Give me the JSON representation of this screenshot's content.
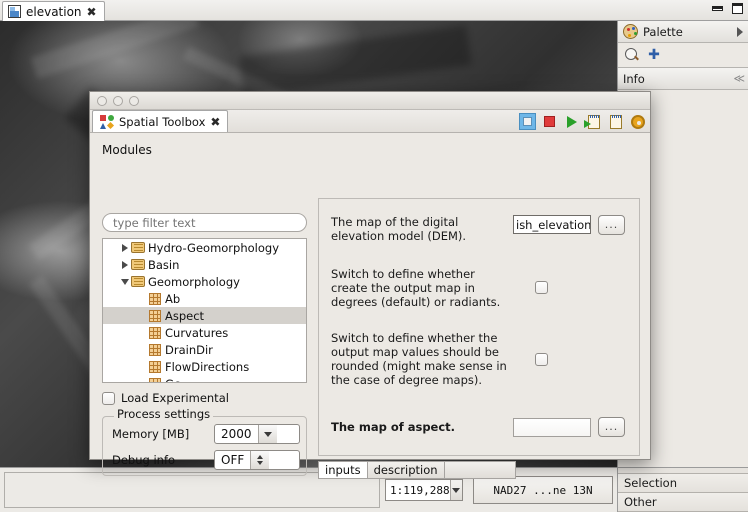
{
  "app": {
    "tab": {
      "label": "elevation",
      "icon": "map-document-icon",
      "close": "✖"
    },
    "window_controls": {
      "minimize": "minimize-icon",
      "maximize": "maximize-icon"
    }
  },
  "right_dock": {
    "palette": {
      "title": "Palette",
      "icon": "palette-icon",
      "expand": "expand-arrow-icon"
    },
    "tools": [
      {
        "name": "zoom-tool",
        "icon": "magnifier-icon"
      },
      {
        "name": "pan-tool",
        "icon": "move-icon"
      }
    ],
    "info": {
      "title": "Info",
      "collapse": "collapse-icon"
    }
  },
  "bottom_right_panels": [
    {
      "label": "Selection"
    },
    {
      "label": "Other"
    }
  ],
  "statusbar": {
    "scale": {
      "value": "1:119,288",
      "dropdown": "chevron-down-icon"
    },
    "crs": "NAD27 ...ne 13N"
  },
  "toolbox": {
    "titlebar_dots": [
      "close-dot",
      "minimize-dot",
      "zoom-dot"
    ],
    "tab": {
      "label": "Spatial Toolbox",
      "icon": "spatial-toolbox-icon",
      "close": "✖"
    },
    "toolbar": [
      {
        "name": "stop-selected-button",
        "icon": "stop-white-icon",
        "selected": true
      },
      {
        "name": "stop-button",
        "icon": "stop-red-icon",
        "selected": false
      },
      {
        "name": "run-button",
        "icon": "play-green-icon",
        "selected": false
      },
      {
        "name": "run-script-button",
        "icon": "script-run-icon",
        "selected": false
      },
      {
        "name": "new-script-button",
        "icon": "script-icon",
        "selected": false
      },
      {
        "name": "settings-button",
        "icon": "gear-icon",
        "selected": false
      }
    ],
    "modules_label": "Modules",
    "filter": {
      "placeholder": "type filter text",
      "value": ""
    },
    "tree": [
      {
        "label": "Hydro-Geomorphology",
        "type": "folder",
        "state": "collapsed",
        "indent": 1,
        "selected": false
      },
      {
        "label": "Basin",
        "type": "folder",
        "state": "collapsed",
        "indent": 1,
        "selected": false
      },
      {
        "label": "Geomorphology",
        "type": "folder",
        "state": "expanded",
        "indent": 1,
        "selected": false
      },
      {
        "label": "Ab",
        "type": "module",
        "state": "leaf",
        "indent": 2,
        "selected": false
      },
      {
        "label": "Aspect",
        "type": "module",
        "state": "leaf",
        "indent": 2,
        "selected": true
      },
      {
        "label": "Curvatures",
        "type": "module",
        "state": "leaf",
        "indent": 2,
        "selected": false
      },
      {
        "label": "DrainDir",
        "type": "module",
        "state": "leaf",
        "indent": 2,
        "selected": false
      },
      {
        "label": "FlowDirections",
        "type": "module",
        "state": "leaf",
        "indent": 2,
        "selected": false
      },
      {
        "label": "Gc",
        "type": "module",
        "state": "leaf",
        "indent": 2,
        "selected": false
      }
    ],
    "load_experimental": {
      "label": "Load Experimental",
      "checked": false
    },
    "process_settings": {
      "title": "Process settings",
      "memory": {
        "label": "Memory [MB]",
        "value": "2000"
      },
      "debug": {
        "label": "Debug info",
        "value": "OFF"
      }
    },
    "form": {
      "dem": {
        "label": "The map of the digital elevation model (DEM).",
        "value": "ish_elevation/elevation.asc",
        "browse": "..."
      },
      "degrees": {
        "label": "Switch to define whether create the output map in degrees (default) or radiants.",
        "checked": false
      },
      "rounded": {
        "label": "Switch to define whether the output map values should be rounded (might make sense in the case of degree maps).",
        "checked": false
      },
      "aspect_out": {
        "label": "The map of aspect.",
        "value": "",
        "browse": "..."
      }
    },
    "bottom_tabs": [
      {
        "label": "inputs",
        "active": true
      },
      {
        "label": "description",
        "active": false
      }
    ]
  }
}
